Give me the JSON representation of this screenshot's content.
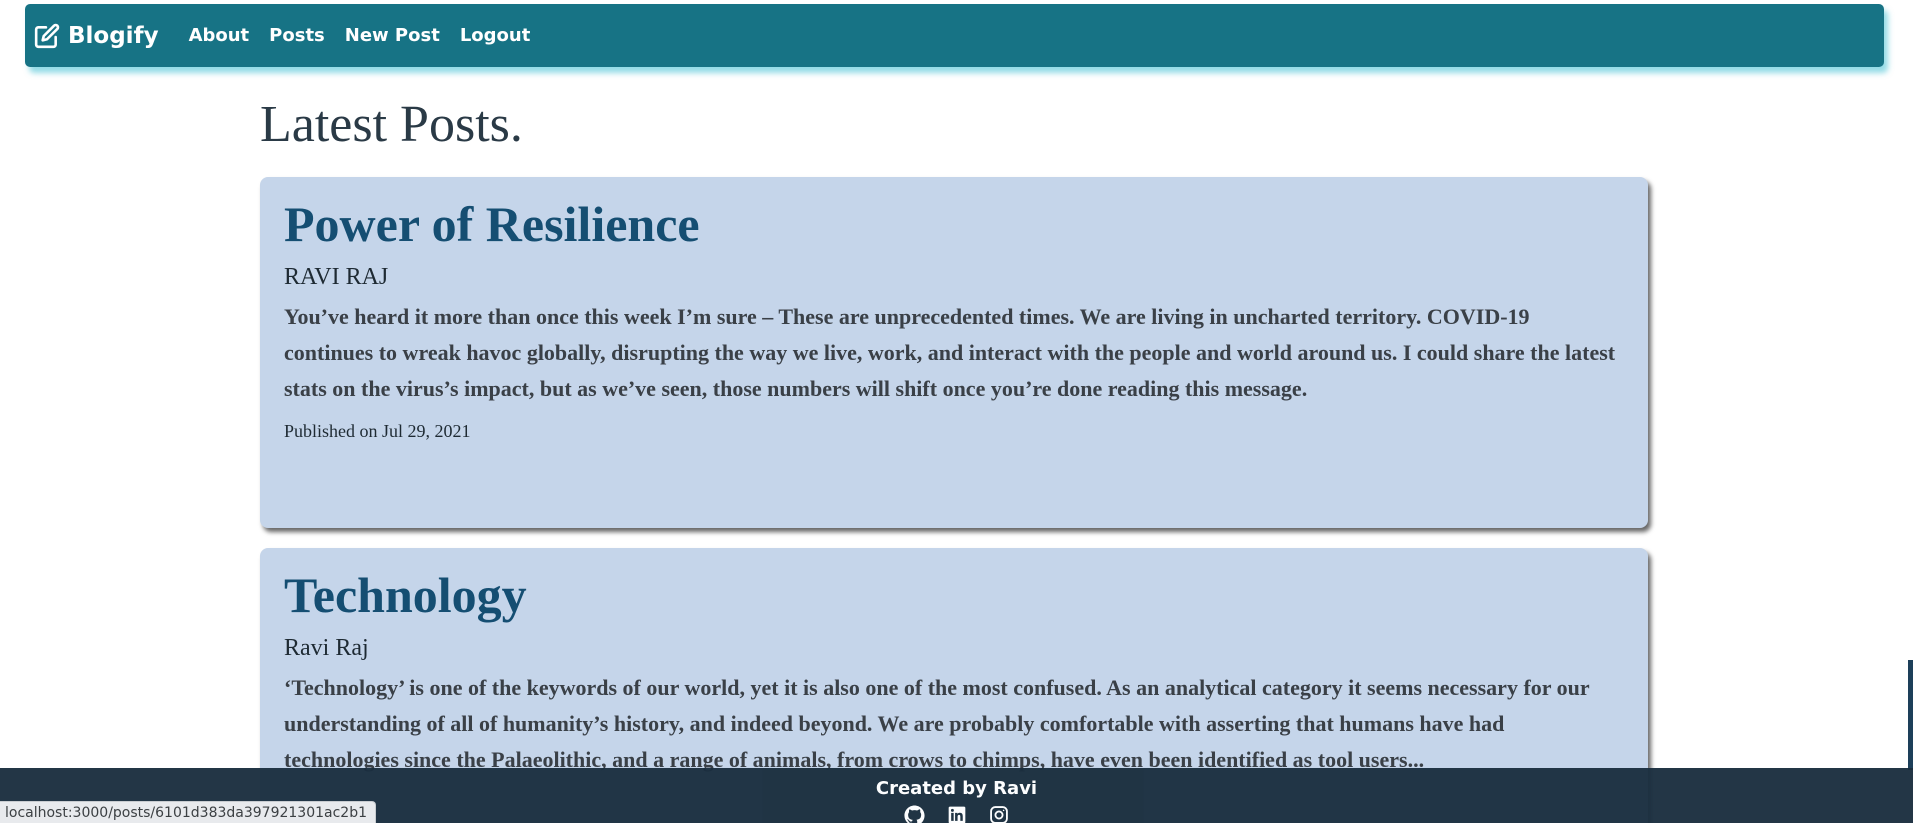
{
  "navbar": {
    "brand": "Blogify",
    "links": [
      "About",
      "Posts",
      "New Post",
      "Logout"
    ],
    "color": "#177385"
  },
  "page_title": "Latest Posts.",
  "posts": [
    {
      "title": "Power of Resilience",
      "author": "RAVI RAJ",
      "body": "You’ve heard it more than once this week I’m sure – These are unprecedented times. We are living in uncharted territory. COVID-19 continues to wreak havoc globally, disrupting the way we live, work, and interact with the people and world around us. I could share the latest stats on the virus’s impact, but as we’ve seen, those numbers will shift once you’re done reading this message.",
      "date": "Published on Jul 29, 2021"
    },
    {
      "title": "Technology",
      "author": "Ravi Raj",
      "body": "‘Technology’ is one of the keywords of our world, yet it is also one of the most confused. As an analytical category it seems necessary for our understanding of all of humanity’s history, and indeed beyond. We are probably comfortable with asserting that humans have had technologies since the Palaeolithic, and a range of animals, from crows to chimps, have even been identified as tool users..."
    }
  ],
  "footer": {
    "text": "Created by Ravi",
    "icons": [
      "github-icon",
      "linkedin-icon",
      "instagram-icon"
    ]
  },
  "status_bar": {
    "url": "localhost:3000/posts/6101d383da397921301ac2b1"
  },
  "colors": {
    "card_bg": "#c5d5ea",
    "post_title": "#154e72",
    "footer_bg": "#1a2e3e"
  }
}
